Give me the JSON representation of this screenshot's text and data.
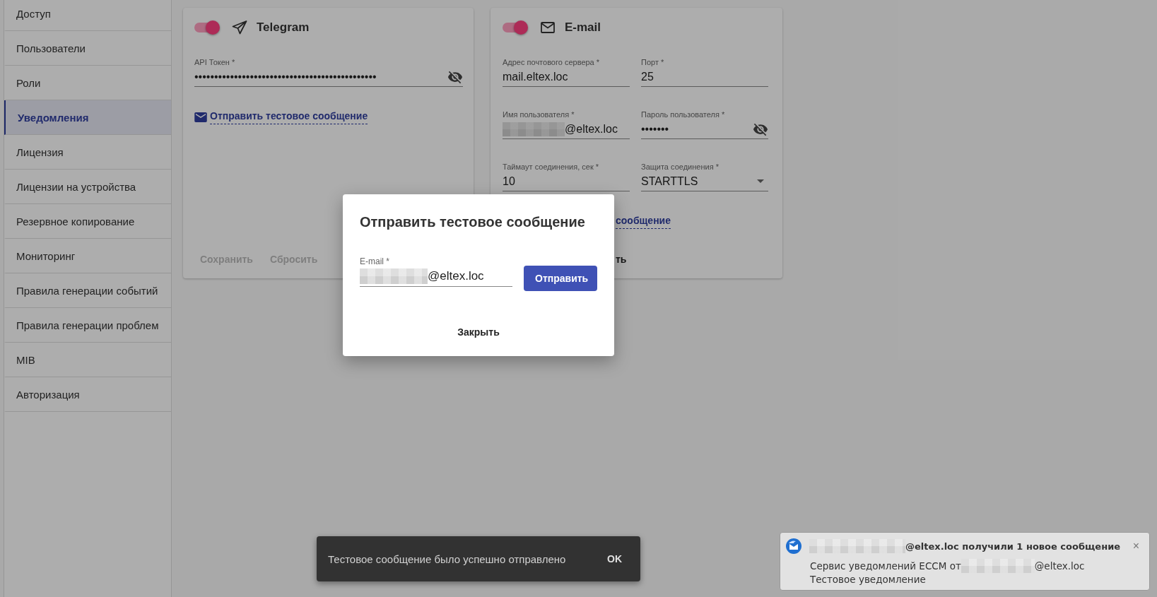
{
  "sidebar": {
    "items": [
      {
        "label": "Доступ",
        "selected": false
      },
      {
        "label": "Пользователи",
        "selected": false
      },
      {
        "label": "Роли",
        "selected": false
      },
      {
        "label": "Уведомления",
        "selected": true
      },
      {
        "label": "Лицензия",
        "selected": false
      },
      {
        "label": "Лицензии на устройства",
        "selected": false
      },
      {
        "label": "Резервное копирование",
        "selected": false
      },
      {
        "label": "Мониторинг",
        "selected": false
      },
      {
        "label": "Правила генерации событий",
        "selected": false
      },
      {
        "label": "Правила генерации проблем",
        "selected": false
      },
      {
        "label": "MIB",
        "selected": false
      },
      {
        "label": "Авторизация",
        "selected": false
      }
    ]
  },
  "cards": [
    {
      "kind": "telegram",
      "title": "Telegram",
      "on": true,
      "covered": false,
      "fields": [
        {
          "kind": "password",
          "label": "API Токен *",
          "value": "••••••••••••••••••••••••••••••••••••••••••••••",
          "redacted": false
        }
      ],
      "test_link": {
        "text": "Отправить тестовое сообщение",
        "icon": true
      },
      "buttons": [
        {
          "label": "Сохранить",
          "disabled": true
        },
        {
          "label": "Сбросить",
          "disabled": true
        }
      ]
    },
    {
      "kind": "email",
      "title": "E-mail",
      "on": true,
      "covered": true,
      "fields": [
        {
          "kind": "text",
          "label": "Адрес почтового сервера *",
          "value": "mail.eltex.loc",
          "redacted": false
        },
        {
          "kind": "text",
          "label": "Порт *",
          "value": "25",
          "redacted": false
        },
        {
          "kind": "text",
          "label": "Имя пользователя *",
          "value": "@eltex.loc",
          "redacted": true
        },
        {
          "kind": "password",
          "label": "Пароль пользователя *",
          "value": "•••••••",
          "redacted": false
        },
        {
          "kind": "text",
          "label": "Таймаут соединения, сек *",
          "value": "10",
          "redacted": false
        },
        {
          "kind": "select",
          "label": "Защита соединения *",
          "value": "STARTTLS",
          "redacted": false
        }
      ],
      "test_link": {
        "text": "сообщение",
        "icon": false
      },
      "buttons": [
        {
          "label": "ть",
          "disabled": false
        }
      ]
    }
  ],
  "dialog": {
    "title": "Отправить тестовое сообщение",
    "field": {
      "label": "E-mail *",
      "value": "@eltex.loc",
      "redacted": true
    },
    "send_button": "Отправить",
    "close_button": "Закрыть"
  },
  "snackbar": {
    "message": "Тестовое сообщение было успешно отправлено",
    "action": "OK"
  },
  "notification": {
    "title": "@eltex.loc получили 1 новое сообщение",
    "title_redacted": true,
    "body_lines": [
      {
        "text": "Сервис уведомлений ECCM от",
        "redacted_after": true,
        "suffix": "@eltex.loc"
      },
      {
        "text": "Тестовое уведомление",
        "redacted_after": false
      }
    ],
    "close": "×"
  }
}
